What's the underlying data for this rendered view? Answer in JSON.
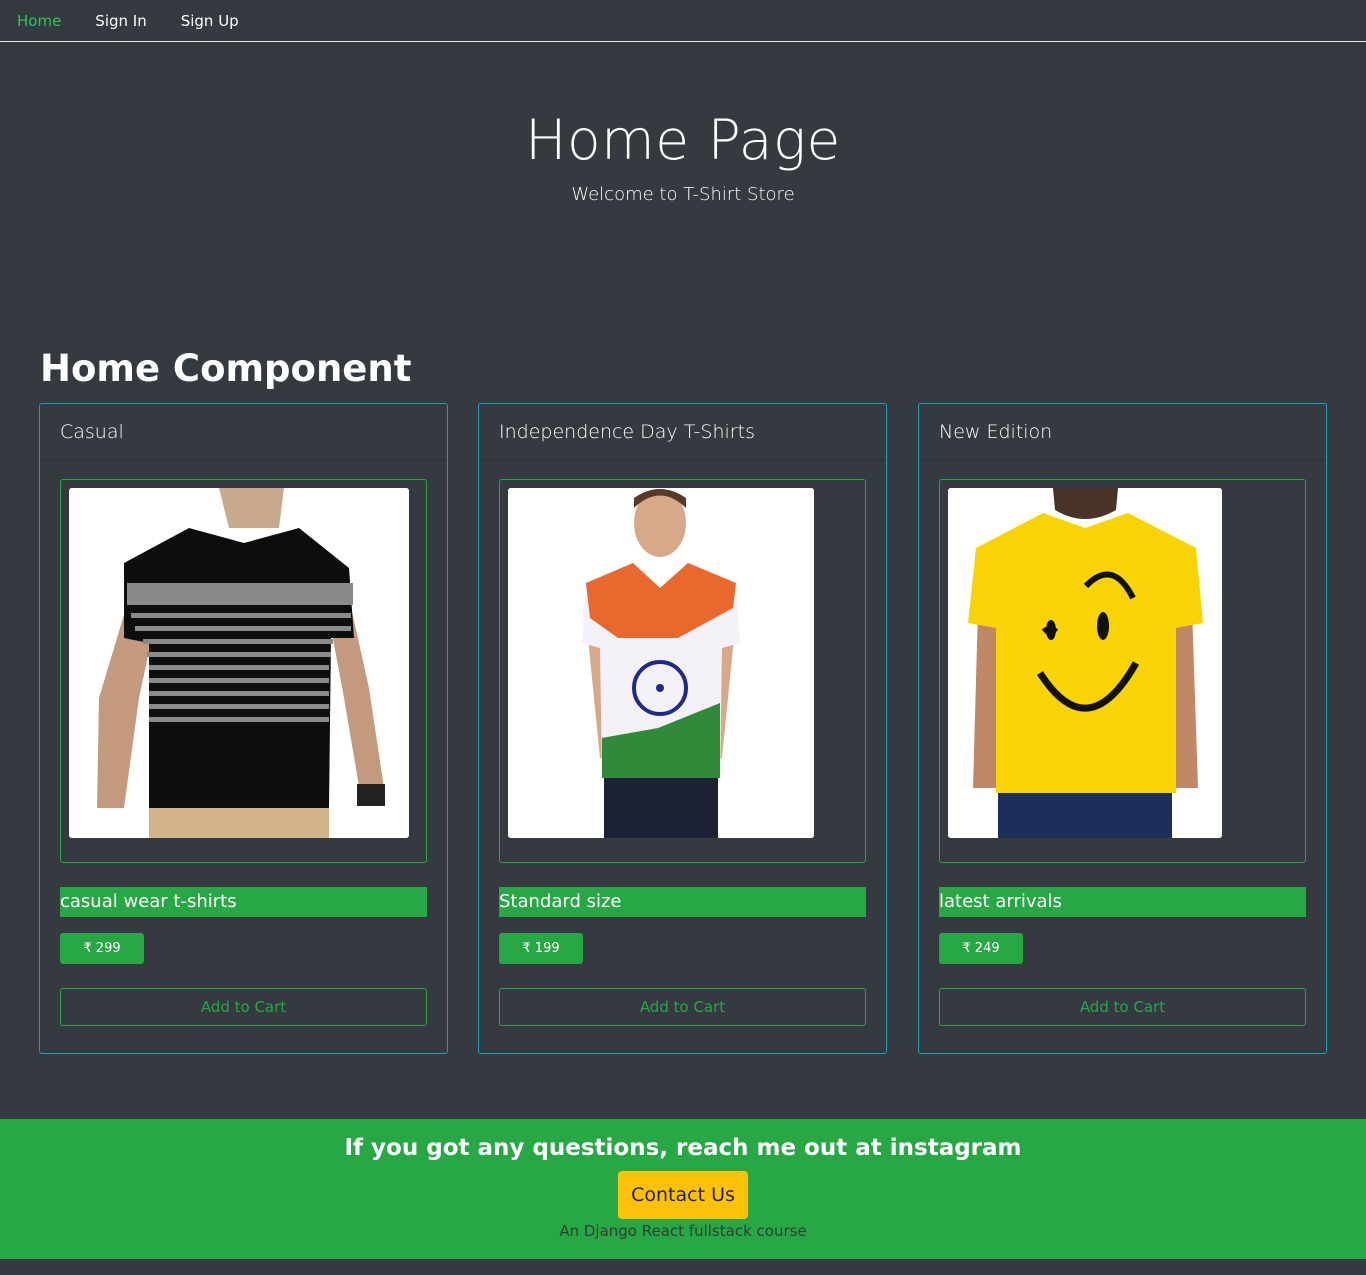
{
  "nav": {
    "items": [
      {
        "label": "Home",
        "active": true
      },
      {
        "label": "Sign In",
        "active": false
      },
      {
        "label": "Sign Up",
        "active": false
      }
    ]
  },
  "hero": {
    "title": "Home Page",
    "subtitle": "Welcome to T-Shirt Store"
  },
  "section": {
    "heading": "Home Component"
  },
  "products": [
    {
      "category": "Casual",
      "description": "casual wear t-shirts",
      "price": "₹ 299",
      "cart_label": "Add to Cart",
      "image_icon": "black-striped-tshirt-photo"
    },
    {
      "category": "Independence Day T-Shirts",
      "description": "Standard size",
      "price": "₹ 199",
      "cart_label": "Add to Cart",
      "image_icon": "tricolor-tshirt-photo"
    },
    {
      "category": "New Edition",
      "description": "latest arrivals",
      "price": "₹ 249",
      "cart_label": "Add to Cart",
      "image_icon": "yellow-smiley-tshirt-photo"
    }
  ],
  "footer": {
    "title": "If you got any questions, reach me out at instagram",
    "contact_label": "Contact Us",
    "note": "An Django React fullstack course"
  },
  "colors": {
    "background": "#343a40",
    "accent_green": "#28a745",
    "card_border": "#17a2b8",
    "contact_button": "#ffc107"
  }
}
